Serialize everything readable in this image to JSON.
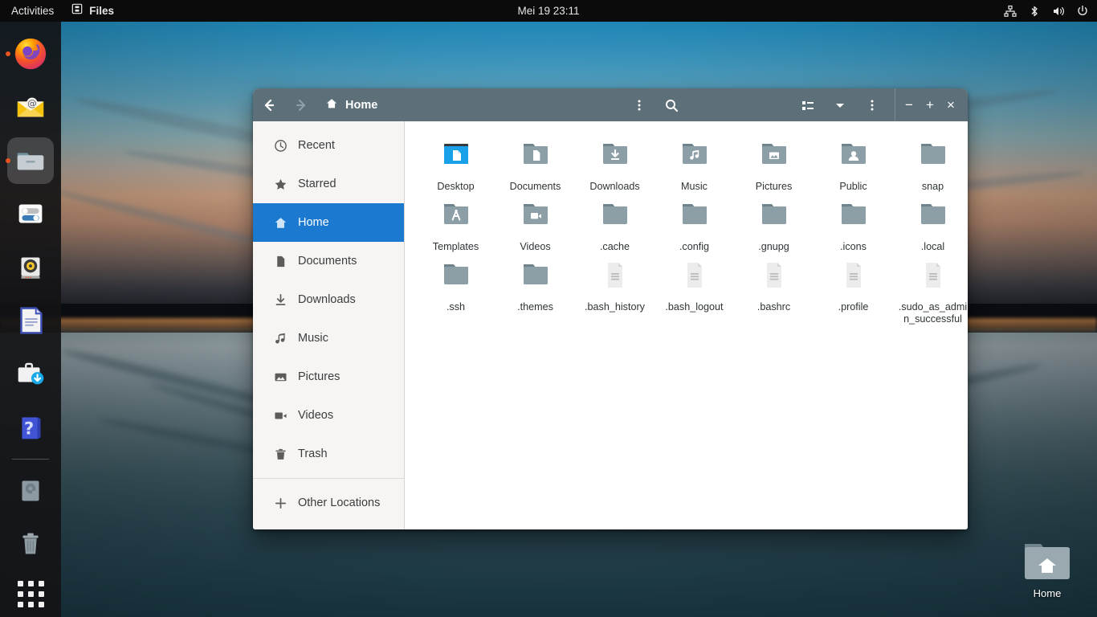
{
  "topbar": {
    "activities": "Activities",
    "app_name": "Files",
    "app_icon": "files-icon",
    "clock": "Mei 19  23:11",
    "tray_icons": [
      "network-wired-icon",
      "bluetooth-icon",
      "volume-icon",
      "power-icon"
    ]
  },
  "dock": {
    "items": [
      {
        "name": "firefox",
        "label": "Firefox",
        "running": true,
        "active": false
      },
      {
        "name": "thunderbird",
        "label": "Thunderbird Mail",
        "running": false,
        "active": false
      },
      {
        "name": "files",
        "label": "Files",
        "running": true,
        "active": true
      },
      {
        "name": "settings",
        "label": "Settings",
        "running": false,
        "active": false
      },
      {
        "name": "rhythmbox",
        "label": "Rhythmbox",
        "running": false,
        "active": false
      },
      {
        "name": "libreoffice-writer",
        "label": "LibreOffice Writer",
        "running": false,
        "active": false
      },
      {
        "name": "ubuntu-software",
        "label": "Ubuntu Software",
        "running": false,
        "active": false
      },
      {
        "name": "help",
        "label": "Help",
        "running": false,
        "active": false
      },
      {
        "name": "disk-drive",
        "label": "Disks",
        "running": false,
        "active": false
      },
      {
        "name": "trash",
        "label": "Trash",
        "running": false,
        "active": false
      }
    ],
    "show_apps_label": "Show Applications"
  },
  "desktop": {
    "home_icon_label": "Home"
  },
  "window": {
    "header": {
      "back_label": "Back",
      "forward_label": "Forward",
      "title": "Home",
      "title_icon": "home-icon",
      "path_menu_label": "Path menu",
      "search_label": "Search",
      "view_list_label": "List view",
      "view_options_label": "View options",
      "main_menu_label": "Main menu",
      "minimize_label": "−",
      "maximize_label": "+",
      "close_label": "×"
    },
    "sidebar": {
      "items": [
        {
          "label": "Recent",
          "icon": "clock-icon",
          "selected": false
        },
        {
          "label": "Starred",
          "icon": "star-icon",
          "selected": false
        },
        {
          "label": "Home",
          "icon": "home-icon",
          "selected": true
        },
        {
          "label": "Documents",
          "icon": "document-icon",
          "selected": false
        },
        {
          "label": "Downloads",
          "icon": "download-icon",
          "selected": false
        },
        {
          "label": "Music",
          "icon": "music-note-icon",
          "selected": false
        },
        {
          "label": "Pictures",
          "icon": "picture-icon",
          "selected": false
        },
        {
          "label": "Videos",
          "icon": "video-camera-icon",
          "selected": false
        },
        {
          "label": "Trash",
          "icon": "trash-icon",
          "selected": false
        }
      ],
      "other_locations": {
        "label": "Other Locations",
        "icon": "plus-icon"
      }
    },
    "files": [
      {
        "name": "Desktop",
        "type": "folder-desktop"
      },
      {
        "name": "Documents",
        "type": "folder-documents"
      },
      {
        "name": "Downloads",
        "type": "folder-downloads"
      },
      {
        "name": "Music",
        "type": "folder-music"
      },
      {
        "name": "Pictures",
        "type": "folder-pictures"
      },
      {
        "name": "Public",
        "type": "folder-public"
      },
      {
        "name": "snap",
        "type": "folder"
      },
      {
        "name": "Templates",
        "type": "folder-templates"
      },
      {
        "name": "Videos",
        "type": "folder-videos"
      },
      {
        "name": ".cache",
        "type": "folder"
      },
      {
        "name": ".config",
        "type": "folder"
      },
      {
        "name": ".gnupg",
        "type": "folder"
      },
      {
        "name": ".icons",
        "type": "folder"
      },
      {
        "name": ".local",
        "type": "folder"
      },
      {
        "name": ".ssh",
        "type": "folder"
      },
      {
        "name": ".themes",
        "type": "folder"
      },
      {
        "name": ".bash_history",
        "type": "text-file"
      },
      {
        "name": ".bash_logout",
        "type": "text-file"
      },
      {
        "name": ".bashrc",
        "type": "text-file"
      },
      {
        "name": ".profile",
        "type": "text-file"
      },
      {
        "name": ".sudo_as_admin_successful",
        "type": "text-file"
      }
    ]
  },
  "colors": {
    "headerbar": "#5d7079",
    "sidebar_bg": "#f6f5f4",
    "selection_blue": "#1b79d0",
    "folder": "#8c9ea6",
    "folder_tab": "#6e838c",
    "desktop_blue": "#18a0e8",
    "accent_orange": "#e95420"
  }
}
